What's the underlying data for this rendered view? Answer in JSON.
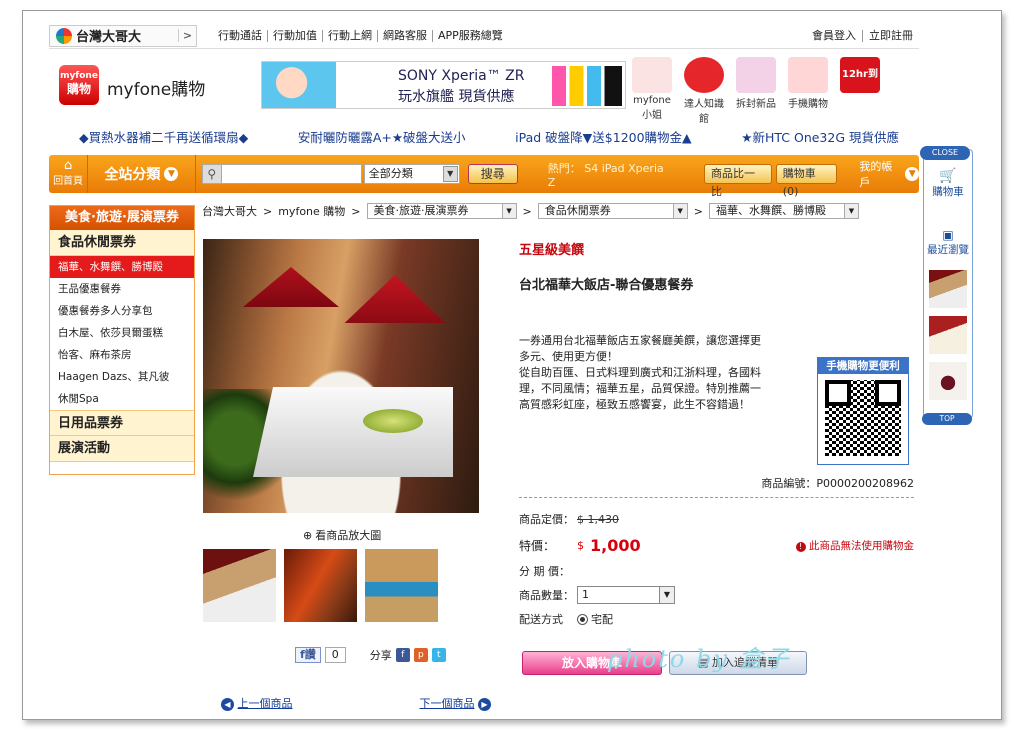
{
  "topbar": {
    "brand": "台灣大哥大",
    "brand_arrow": ">",
    "links": [
      "行動通話",
      "行動加值",
      "行動上網",
      "網路客服",
      "APP服務總覽"
    ],
    "account": [
      "會員登入",
      "立即註冊"
    ]
  },
  "logo": {
    "badge_top": "myfone",
    "badge_bottom": "購物",
    "text": "myfone購物"
  },
  "banner": {
    "line1": "SONY Xperia™ ZR",
    "line2": "玩水旗艦  現貨供應"
  },
  "promos": [
    {
      "label": "myfone小姐",
      "color": "#fbe3e3"
    },
    {
      "label": "達人知識館",
      "color": "#e5262b"
    },
    {
      "label": "拆封新品",
      "color": "#f3d2e8"
    },
    {
      "label": "手機購物",
      "color": "#ffd6d6"
    },
    {
      "label": "12hr到貨",
      "color": "#d8131b"
    }
  ],
  "marquee": [
    "◆買熱水器補二千再送循環扇◆",
    "安耐曬防曬露A+★破盤大送小",
    "iPad 破盤降▼送$1200購物金▲",
    "★新HTC One32G 現貨供應"
  ],
  "nav": {
    "home": "回首頁",
    "all_categories": "全站分類",
    "search_placeholder": "",
    "category_select": "全部分類",
    "search_button": "搜尋",
    "hot_keywords": "熱門：  S4  iPad  Xperia Z",
    "compare": "商品比一比",
    "cart": "購物車(0)",
    "my_account": "我的帳戶"
  },
  "breadcrumb": {
    "home": "台灣大哥大",
    "shop": "myfone 購物",
    "level1": "美食·旅遊·展演票券",
    "level2": "食品休閒票券",
    "level3": "福華、水舞饌、勝博殿"
  },
  "sidebar": {
    "header": "美食·旅遊·展演票券",
    "category1": "食品休閒票券",
    "items": [
      "福華、水舞饌、勝博殿",
      "王品優惠餐券",
      "優惠餐券多人分享包",
      "白木屋、依莎貝爾蛋糕",
      "怡客、麻布茶房",
      "Haagen Dazs、其凡彼",
      "休閒Spa"
    ],
    "active_index": 0,
    "category2": "日用品票券",
    "category3": "展演活動"
  },
  "product": {
    "tag": "五星級美饌",
    "name": "台北福華大飯店-聯合優惠餐券",
    "description": "一券通用台北福華飯店五家餐廳美饌，讓您選擇更多元、使用更方便！\n從自助百匯、日式料理到廣式和江浙料理，各國料理，不同風情；福華五星，品質保證。特別推薦一高質感彩虹座，極致五感饗宴，此生不容錯過！",
    "qr_title": "手機購物更便利",
    "code": "商品編號：P0000200208962",
    "zoom": "看商品放大圖",
    "list_price_label": "商品定價：",
    "list_price": "$ 1,430",
    "sale_label": "特價：",
    "sale_currency": "$",
    "sale_price": "1,000",
    "warning": "此商品無法使用購物金",
    "installment_label": "分 期 價：",
    "qty_label": "商品數量：",
    "qty_value": "1",
    "ship_label": "配送方式",
    "ship_value": "宅配",
    "add_cart": "放入購物車",
    "add_track": "加入追蹤清單"
  },
  "social": {
    "like": "f讚",
    "count": "0",
    "share": "分享"
  },
  "paging": {
    "prev": "上一個商品",
    "next": "下一個商品"
  },
  "right_panel": {
    "close": "CLOSE",
    "cart": "購物車",
    "recent": "最近瀏覽",
    "top": "TOP"
  },
  "watermark": "photo by 盒子"
}
